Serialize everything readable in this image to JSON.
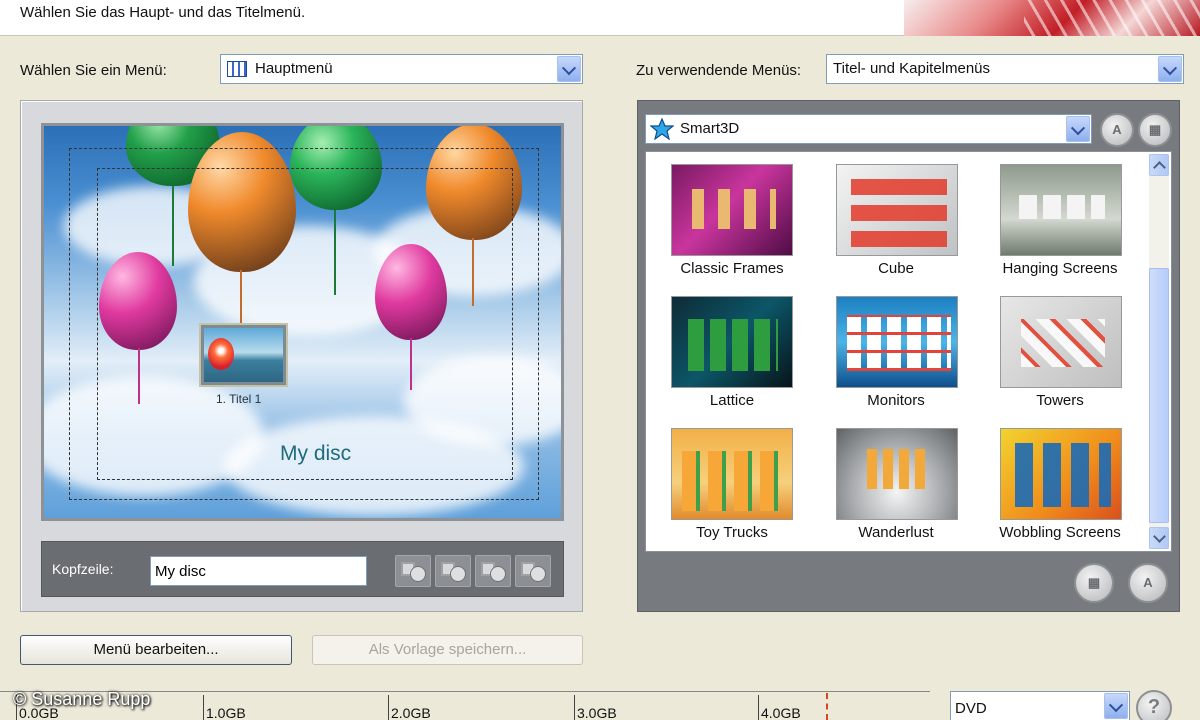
{
  "header": {
    "title": "Wählen Sie das Haupt- und das Titelmenü."
  },
  "menu_select": {
    "label": "Wählen Sie ein Menü:",
    "value": "Hauptmenü"
  },
  "menus_used": {
    "label": "Zu verwendende Menüs:",
    "value": "Titel- und Kapitelmenüs"
  },
  "preview": {
    "thumb_label": "1. Titel 1",
    "disc_title": "My disc",
    "caption_label": "Kopfzeile:",
    "caption_value": "My disc"
  },
  "template": {
    "category": "Smart3D",
    "items": [
      {
        "label": "Classic Frames"
      },
      {
        "label": "Cube"
      },
      {
        "label": "Hanging Screens"
      },
      {
        "label": "Lattice"
      },
      {
        "label": "Monitors"
      },
      {
        "label": "Towers"
      },
      {
        "label": "Toy Trucks"
      },
      {
        "label": "Wanderlust"
      },
      {
        "label": "Wobbling Screens"
      }
    ]
  },
  "buttons": {
    "edit_menu": "Menü bearbeiten...",
    "save_template": "Als Vorlage speichern..."
  },
  "capacity": {
    "ticks": [
      "0.0GB",
      "1.0GB",
      "2.0GB",
      "3.0GB",
      "4.0GB"
    ],
    "disc_type": "DVD"
  },
  "watermark": "© Susanne Rupp",
  "colors": {
    "accent": "#7f9db9",
    "panel_dark": "#777b7f",
    "background": "#ece9d8"
  }
}
